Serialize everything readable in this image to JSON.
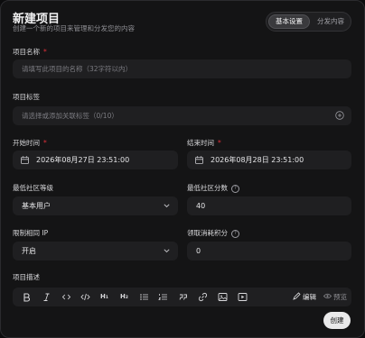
{
  "header": {
    "title": "新建项目",
    "subtitle": "创建一个新的项目来管理和分发您的内容"
  },
  "tabs": [
    {
      "label": "基本设置",
      "active": true
    },
    {
      "label": "分发内容",
      "active": false
    }
  ],
  "fields": {
    "name": {
      "label": "项目名称",
      "required": "*",
      "placeholder": "请填写此项目的名称（32字符以内）"
    },
    "tags": {
      "label": "项目标签",
      "placeholder": "请选择或添加关联标签（0/10）"
    },
    "start_time": {
      "label": "开始时间",
      "required": "*",
      "value": "2026年08月27日 23:51:00"
    },
    "end_time": {
      "label": "结束时间",
      "required": "*",
      "value": "2026年08月28日 23:51:00"
    },
    "min_level": {
      "label": "最低社区等级",
      "value": "基本用户"
    },
    "min_score": {
      "label": "最低社区分数",
      "value": "40",
      "help": "?"
    },
    "ip_limit": {
      "label": "限制相同 IP",
      "value": "开启"
    },
    "cost_points": {
      "label": "领取消耗积分",
      "value": "0",
      "help": "?"
    },
    "description": {
      "label": "项目描述"
    }
  },
  "editor_toolbar": {
    "buttons": [
      "bold",
      "italic",
      "code",
      "code-block",
      "h1",
      "h2",
      "bullet-list",
      "ordered-list",
      "quote",
      "link",
      "image",
      "video"
    ],
    "h1_label": "H₁",
    "h2_label": "H₂",
    "edit_label": "编辑",
    "preview_label": "预览"
  },
  "actions": {
    "create_label": "创建"
  },
  "colors": {
    "background": "#141415",
    "field": "#1f1f21",
    "required": "#e0303a",
    "primary_button": "#e9e9ea"
  }
}
